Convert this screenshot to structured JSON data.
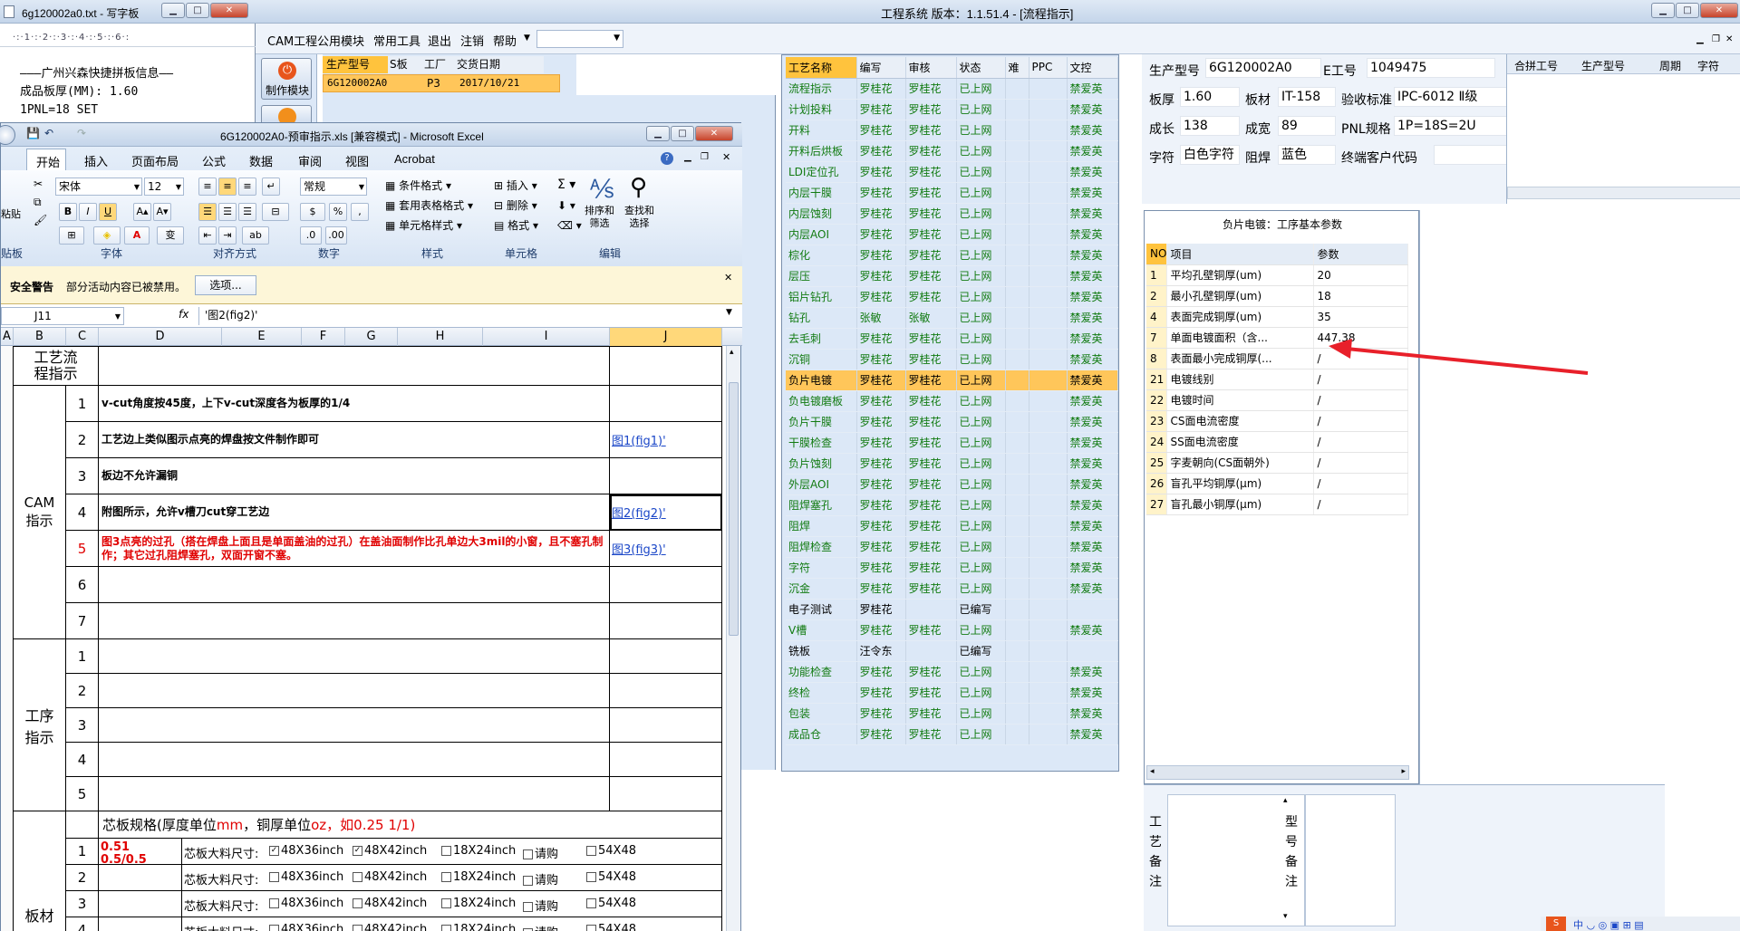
{
  "engineering": {
    "title": "工程系统   版本：1.1.51.4 - [流程指示]",
    "menu": [
      "CAM工程",
      "公用模块",
      "常用工具",
      "退出",
      "注销",
      "帮助"
    ],
    "left_buttons": [
      "制作模块"
    ],
    "order_table": {
      "headers": [
        "生产型号",
        "S板",
        "工厂",
        "交货日期"
      ],
      "row": [
        "6G120002A0",
        "",
        "P3",
        "2017/10/21"
      ]
    },
    "process_table": {
      "headers": [
        "工艺名称",
        "编写",
        "审核",
        "状态",
        "难",
        "PPC",
        "文控"
      ],
      "rows": [
        [
          "流程指示",
          "罗桂花",
          "罗桂花",
          "已上网",
          "",
          "",
          "禁爱英"
        ],
        [
          "计划投料",
          "罗桂花",
          "罗桂花",
          "已上网",
          "",
          "",
          "禁爱英"
        ],
        [
          "开料",
          "罗桂花",
          "罗桂花",
          "已上网",
          "",
          "",
          "禁爱英"
        ],
        [
          "开料后烘板",
          "罗桂花",
          "罗桂花",
          "已上网",
          "",
          "",
          "禁爱英"
        ],
        [
          "LDI定位孔",
          "罗桂花",
          "罗桂花",
          "已上网",
          "",
          "",
          "禁爱英"
        ],
        [
          "内层干膜",
          "罗桂花",
          "罗桂花",
          "已上网",
          "",
          "",
          "禁爱英"
        ],
        [
          "内层蚀刻",
          "罗桂花",
          "罗桂花",
          "已上网",
          "",
          "",
          "禁爱英"
        ],
        [
          "内层AOI",
          "罗桂花",
          "罗桂花",
          "已上网",
          "",
          "",
          "禁爱英"
        ],
        [
          "棕化",
          "罗桂花",
          "罗桂花",
          "已上网",
          "",
          "",
          "禁爱英"
        ],
        [
          "层压",
          "罗桂花",
          "罗桂花",
          "已上网",
          "",
          "",
          "禁爱英"
        ],
        [
          "铝片钻孔",
          "罗桂花",
          "罗桂花",
          "已上网",
          "",
          "",
          "禁爱英"
        ],
        [
          "钻孔",
          "张敏",
          "张敏",
          "已上网",
          "",
          "",
          "禁爱英"
        ],
        [
          "去毛刺",
          "罗桂花",
          "罗桂花",
          "已上网",
          "",
          "",
          "禁爱英"
        ],
        [
          "沉铜",
          "罗桂花",
          "罗桂花",
          "已上网",
          "",
          "",
          "禁爱英"
        ],
        [
          "负片电镀",
          "罗桂花",
          "罗桂花",
          "已上网",
          "",
          "",
          "禁爱英"
        ],
        [
          "负电镀磨板",
          "罗桂花",
          "罗桂花",
          "已上网",
          "",
          "",
          "禁爱英"
        ],
        [
          "负片干膜",
          "罗桂花",
          "罗桂花",
          "已上网",
          "",
          "",
          "禁爱英"
        ],
        [
          "干膜检查",
          "罗桂花",
          "罗桂花",
          "已上网",
          "",
          "",
          "禁爱英"
        ],
        [
          "负片蚀刻",
          "罗桂花",
          "罗桂花",
          "已上网",
          "",
          "",
          "禁爱英"
        ],
        [
          "外层AOI",
          "罗桂花",
          "罗桂花",
          "已上网",
          "",
          "",
          "禁爱英"
        ],
        [
          "阻焊塞孔",
          "罗桂花",
          "罗桂花",
          "已上网",
          "",
          "",
          "禁爱英"
        ],
        [
          "阻焊",
          "罗桂花",
          "罗桂花",
          "已上网",
          "",
          "",
          "禁爱英"
        ],
        [
          "阻焊检查",
          "罗桂花",
          "罗桂花",
          "已上网",
          "",
          "",
          "禁爱英"
        ],
        [
          "字符",
          "罗桂花",
          "罗桂花",
          "已上网",
          "",
          "",
          "禁爱英"
        ],
        [
          "沉金",
          "罗桂花",
          "罗桂花",
          "已上网",
          "",
          "",
          "禁爱英"
        ],
        [
          "电子测试",
          "罗桂花",
          "",
          "已编写",
          "",
          "",
          ""
        ],
        [
          "V槽",
          "罗桂花",
          "罗桂花",
          "已上网",
          "",
          "",
          "禁爱英"
        ],
        [
          "铣板",
          "汪令东",
          "",
          "已编写",
          "",
          "",
          ""
        ],
        [
          "功能检查",
          "罗桂花",
          "罗桂花",
          "已上网",
          "",
          "",
          "禁爱英"
        ],
        [
          "终检",
          "罗桂花",
          "罗桂花",
          "已上网",
          "",
          "",
          "禁爱英"
        ],
        [
          "包装",
          "罗桂花",
          "罗桂花",
          "已上网",
          "",
          "",
          "禁爱英"
        ],
        [
          "成品仓",
          "罗桂花",
          "罗桂花",
          "已上网",
          "",
          "",
          "禁爱英"
        ]
      ],
      "selected_index": 14
    },
    "info": {
      "prod_model_label": "生产型号",
      "prod_model": "6G120002A0",
      "e_no_label": "E工号",
      "e_no": "1049475",
      "thickness_label": "板厚",
      "thickness": "1.60",
      "material_label": "板材",
      "material": "IT-158",
      "accept_label": "验收标准",
      "accept": "IPC-6012 Ⅱ级",
      "length_label": "成长",
      "length": "138",
      "width_label": "成宽",
      "width": "89",
      "pnl_label": "PNL规格",
      "pnl": "1P=18S=2U",
      "char_label": "字符",
      "char": "白色字符",
      "mask_label": "阻焊",
      "mask": "蓝色",
      "customer_label": "终端客户代码",
      "customer": ""
    },
    "merge_table": {
      "headers": [
        "合拼工号",
        "生产型号",
        "周期",
        "字符"
      ]
    },
    "params": {
      "title": "负片电镀：工序基本参数",
      "headers": [
        "NO",
        "项目",
        "参数"
      ],
      "rows": [
        [
          "1",
          "平均孔壁铜厚(um)",
          "20"
        ],
        [
          "2",
          "最小孔壁铜厚(um)",
          "18"
        ],
        [
          "4",
          "表面完成铜厚(um)",
          "35"
        ],
        [
          "7",
          "单面电镀面积（含...",
          "447.38"
        ],
        [
          "8",
          "表面最小完成铜厚(...",
          "/"
        ],
        [
          "21",
          "电镀线别",
          "/"
        ],
        [
          "22",
          "电镀时间",
          "/"
        ],
        [
          "23",
          "CS面电流密度",
          "/"
        ],
        [
          "24",
          "SS面电流密度",
          "/"
        ],
        [
          "25",
          "字麦朝向(CS面朝外)",
          "/"
        ],
        [
          "26",
          "盲孔平均铜厚(μm)",
          "/"
        ],
        [
          "27",
          "盲孔最小铜厚(μm)",
          "/"
        ]
      ]
    },
    "notes": {
      "process_label": "工艺备注",
      "model_label": "型号备注"
    }
  },
  "notepad": {
    "title": "6g120002a0.txt - 写字板",
    "line1": "———广州兴森快捷拼板信息——",
    "line2": "成品板厚(MM): 1.60",
    "line3": "1PNL=18 SET"
  },
  "excel": {
    "title": "6G120002A0-预审指示.xls  [兼容模式] - Microsoft Excel",
    "tabs": [
      "开始",
      "插入",
      "页面布局",
      "公式",
      "数据",
      "审阅",
      "视图",
      "Acrobat"
    ],
    "font_name": "宋体",
    "font_size": "12",
    "number_format": "常规",
    "groups": [
      "贴板",
      "字体",
      "对齐方式",
      "数字",
      "样式",
      "单元格",
      "编辑"
    ],
    "style_buttons": [
      "条件格式",
      "套用表格格式",
      "单元格样式"
    ],
    "cell_buttons": [
      "插入",
      "删除",
      "格式"
    ],
    "edit_buttons": [
      "排序和\n筛选",
      "查找和\n选择"
    ],
    "security_title": "安全警告",
    "security_msg": "部分活动内容已被禁用。",
    "security_btn": "选项...",
    "name_box": "J11",
    "formula": "'图2(fig2)'",
    "columns": [
      "A",
      "B",
      "C",
      "D",
      "E",
      "F",
      "G",
      "H",
      "I",
      "J"
    ],
    "section_titles": {
      "flow": "工艺流程指示",
      "cam": "CAM指示",
      "process": "工序指示",
      "board": "板材"
    },
    "cam_rows": [
      {
        "no": "1",
        "text": "v-cut角度按45度，上下v-cut深度各为板厚的1/4",
        "link": ""
      },
      {
        "no": "2",
        "text": "工艺边上类似图示点亮的焊盘按文件制作即可",
        "link": "图1(fig1)'"
      },
      {
        "no": "3",
        "text": "板边不允许漏铜",
        "link": ""
      },
      {
        "no": "4",
        "text": "附图所示，允许v槽刀cut穿工艺边",
        "link": "图2(fig2)'"
      },
      {
        "no": "5",
        "text": "图3点亮的过孔（搭在焊盘上面且是单面盖油的过孔）在盖油面制作比孔单边大3mil的小窗，且不塞孔制作；其它过孔阻焊塞孔，双面开窗不塞。",
        "link": "图3(fig3)'"
      },
      {
        "no": "6",
        "text": "",
        "link": ""
      },
      {
        "no": "7",
        "text": "",
        "link": ""
      }
    ],
    "process_rows": [
      "1",
      "2",
      "3",
      "4",
      "5"
    ],
    "core_header_a": "芯板规格(厚度单位",
    "core_header_unit1": "mm",
    "core_header_b": "，铜厚单位",
    "core_header_unit2": "oz",
    "core_header_c": "，如0.25 1/1)",
    "core_rows": [
      {
        "no": "1",
        "spec": "0.51\n0.5/0.5"
      },
      {
        "no": "2",
        "spec": ""
      },
      {
        "no": "3",
        "spec": ""
      },
      {
        "no": "4",
        "spec": ""
      }
    ],
    "material_label": "芯板大料尺寸:",
    "sizes": [
      "48X36inch",
      "48X42inch",
      "18X24inch",
      "请购",
      "54X48"
    ]
  }
}
